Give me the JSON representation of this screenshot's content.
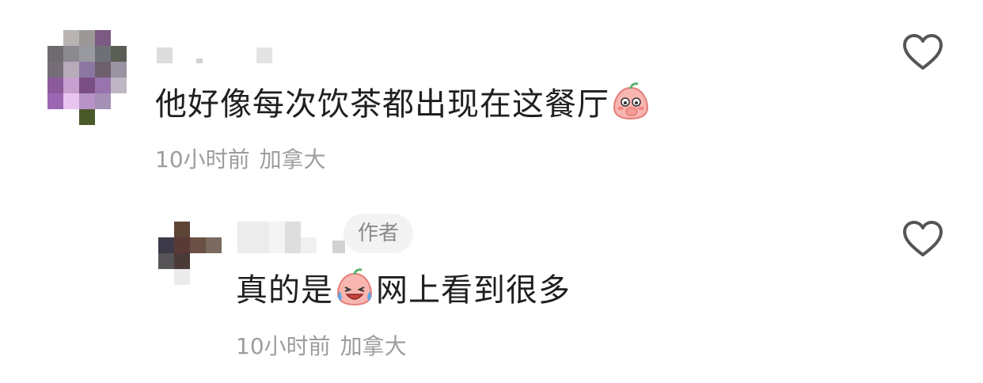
{
  "comments": [
    {
      "text_before": "他好像每次饮茶都出现在这餐厅",
      "text_after": "",
      "emoji": "blushing-peach-emoji",
      "time": "10小时前",
      "location": "加拿大",
      "username_hidden": true
    }
  ],
  "reply": {
    "author_badge": "作者",
    "text_before": "真的是",
    "text_after": "网上看到很多",
    "emoji": "crying-laughing-peach-emoji",
    "time": "10小时前",
    "location": "加拿大",
    "username_hidden": true
  },
  "icons": {
    "like": "heart-outline-icon"
  },
  "colors": {
    "text": "#1f1f1f",
    "meta": "#9d9d9d",
    "badge_bg": "#f3f3f3",
    "heart": "#555555"
  }
}
